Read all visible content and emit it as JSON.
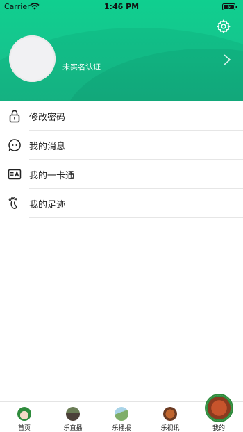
{
  "status_bar": {
    "carrier": "Carrier",
    "time": "1:46 PM"
  },
  "profile": {
    "verification_status": "未实名认证"
  },
  "menu": {
    "items": [
      {
        "label": "修改密码",
        "icon": "lock-icon"
      },
      {
        "label": "我的消息",
        "icon": "message-icon"
      },
      {
        "label": "我的一卡通",
        "icon": "card-icon"
      },
      {
        "label": "我的足迹",
        "icon": "footprint-icon"
      }
    ]
  },
  "tab_bar": {
    "tabs": [
      {
        "label": "首页",
        "icon": "home-tab-icon"
      },
      {
        "label": "乐直播",
        "icon": "live-tab-icon"
      },
      {
        "label": "乐播报",
        "icon": "report-tab-icon"
      },
      {
        "label": "乐视讯",
        "icon": "video-tab-icon"
      },
      {
        "label": "我的",
        "icon": "mine-tab-icon",
        "selected": true
      }
    ]
  },
  "colors": {
    "header_green": "#16c38d",
    "tab_icon_green": "#2e8b3c"
  }
}
